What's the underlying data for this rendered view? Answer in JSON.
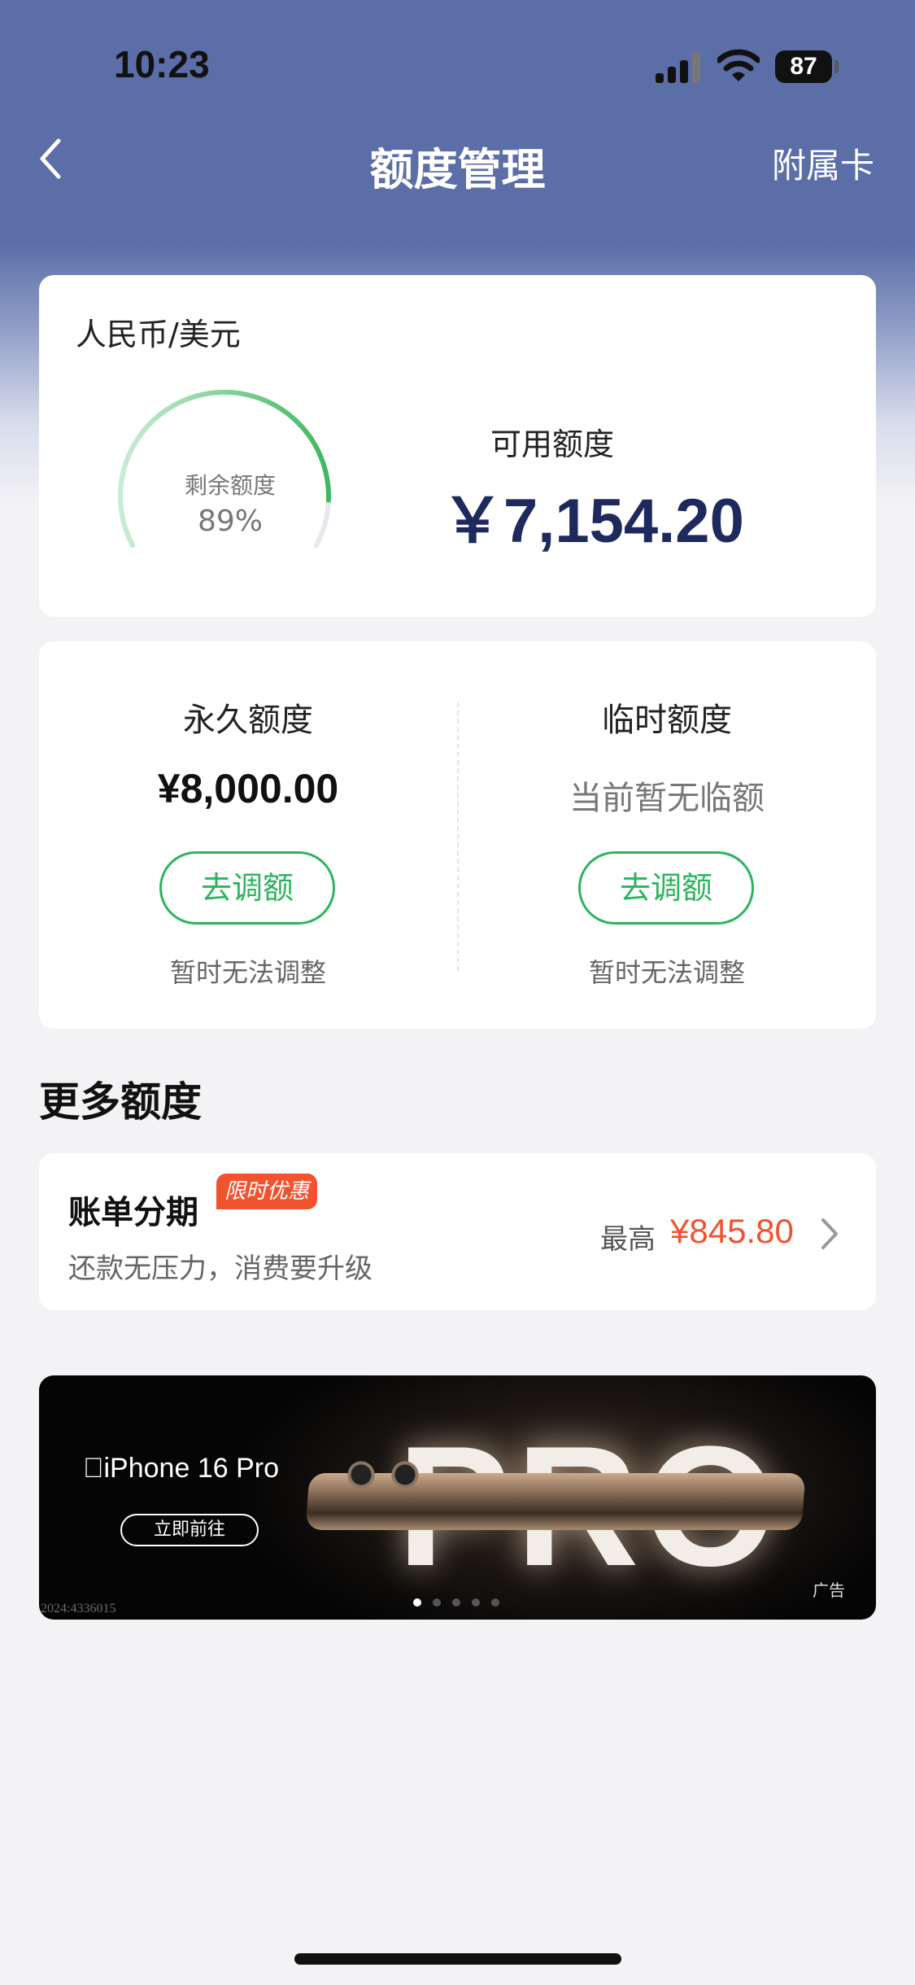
{
  "status_bar": {
    "time": "10:23",
    "battery": "87"
  },
  "nav": {
    "title": "额度管理",
    "right_action": "附属卡"
  },
  "credit_summary": {
    "currency": "人民币/美元",
    "gauge_label": "剩余额度",
    "remaining_percent": "89%",
    "remaining_fraction": 0.89,
    "available_label": "可用额度",
    "available_amount": "￥7,154.20"
  },
  "limits": {
    "permanent": {
      "title": "永久额度",
      "value": "¥8,000.00",
      "button": "去调额",
      "note": "暂时无法调整"
    },
    "temporary": {
      "title": "临时额度",
      "value": "当前暂无临额",
      "button": "去调额",
      "note": "暂时无法调整"
    }
  },
  "more_section": {
    "title": "更多额度"
  },
  "installment": {
    "title": "账单分期",
    "badge": "限时优惠",
    "subtitle": "还款无压力，消费要升级",
    "max_label": "最高",
    "max_amount": "¥845.80"
  },
  "banner": {
    "product": "iPhone 16 Pro",
    "big_word": "PRO",
    "cta": "立即前往",
    "ad_label": "广告",
    "code": "2024:4336015",
    "pages": 5,
    "active_page": 0
  },
  "colors": {
    "header": "#5b6ea8",
    "accent_green": "#2db55d",
    "promo_orange": "#f2532f",
    "amount_navy": "#1e2a5e"
  }
}
